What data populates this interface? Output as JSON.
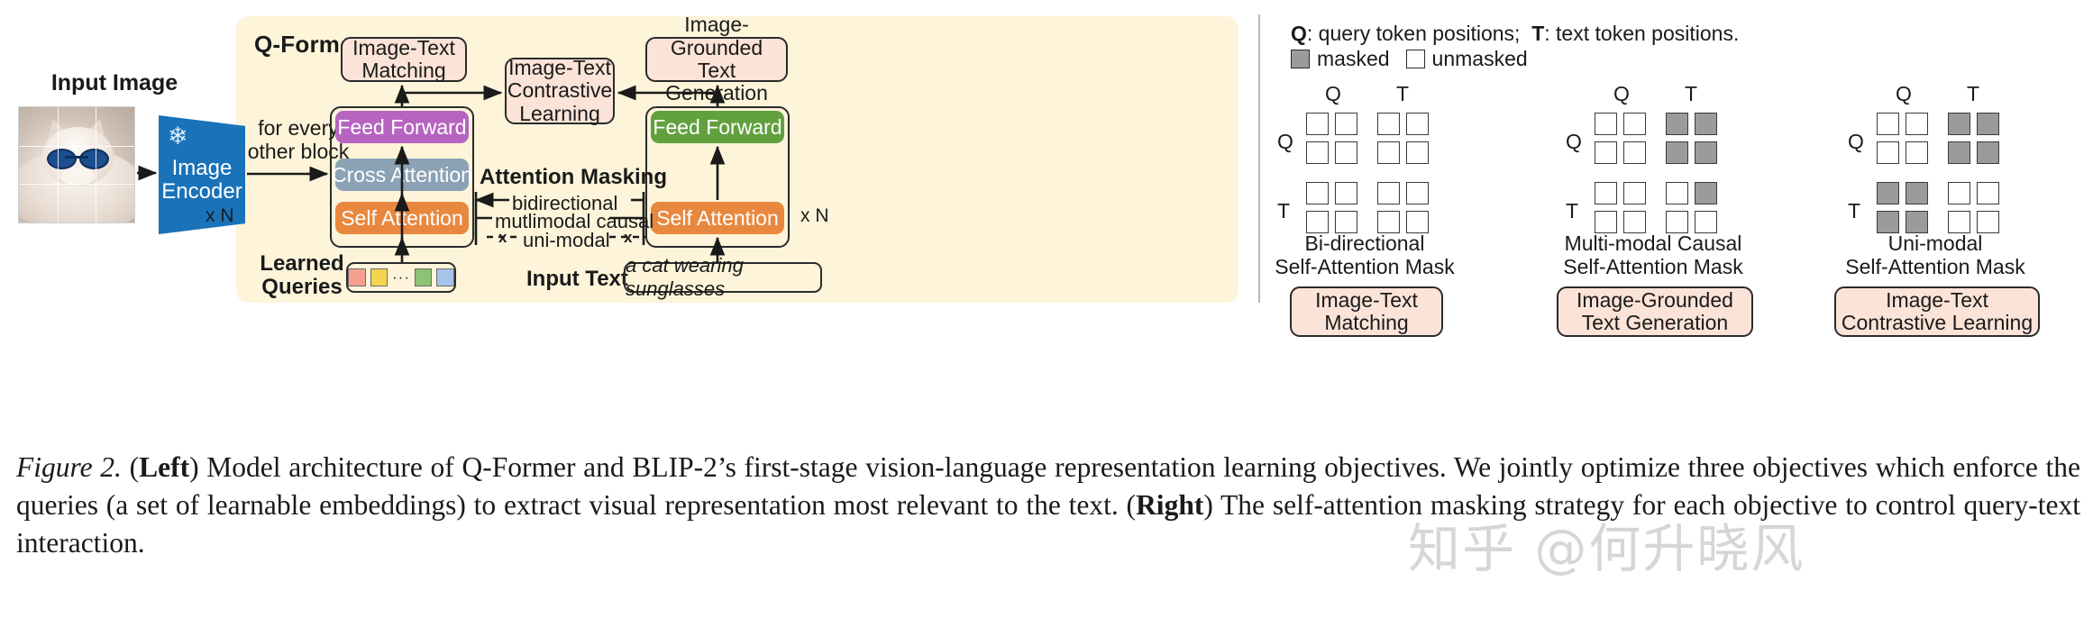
{
  "figure": {
    "label": "Figure 2.",
    "caption_parts": {
      "left_tag": "Left",
      "text_a": ") Model architecture of Q-Former and BLIP-2’s first-stage vision-language representation learning objectives. We jointly optimize three objectives which enforce the queries (a set of learnable embeddings) to extract visual representation most relevant to the text. (",
      "right_tag": "Right",
      "text_b": ") The self-attention masking strategy for each objective to control query-text interaction."
    }
  },
  "left_panel": {
    "panel_title": "Q-Former",
    "input_image_label": "Input Image",
    "image_encoder": {
      "label_line1": "Image",
      "label_line2": "Encoder",
      "frozen_icon": "snowflake-icon"
    },
    "for_every_other_block": "for every\nother block",
    "repeat_left": "x N",
    "repeat_right": "x N",
    "objectives": {
      "image_text_matching": "Image-Text\nMatching",
      "image_text_contrastive_learning": "Image-Text\nContrastive\nLearning",
      "image_grounded_text_generation": "Image-Grounded\nText Generation"
    },
    "left_transformer_blocks": [
      {
        "name": "Feed Forward",
        "color": "#b664c0"
      },
      {
        "name": "Cross Attention",
        "color": "#8ba2b4"
      },
      {
        "name": "Self Attention",
        "color": "#e8883f"
      }
    ],
    "right_transformer_blocks": [
      {
        "name": "Feed Forward",
        "color": "#62a03e"
      },
      {
        "name": "Self Attention",
        "color": "#e8883f"
      }
    ],
    "attention_masking": {
      "title": "Attention Masking",
      "modes": [
        "bidirectional",
        "mutlimodal causal",
        "uni-modal"
      ]
    },
    "learned_queries": {
      "label": "Learned\nQueries",
      "swatch_colors": [
        "#f4a08f",
        "#f6d44d",
        "#8cc275",
        "#a6c3e8"
      ],
      "ellipsis": "···"
    },
    "input_text": {
      "label": "Input Text",
      "value": "a cat wearing sunglasses"
    }
  },
  "right_panel": {
    "legend": {
      "q_key": "Q",
      "q_desc": ": query token positions;",
      "t_key": "T",
      "t_desc": ": text token positions.",
      "masked_label": "masked",
      "unmasked_label": "unmasked",
      "masked_color": "#9b9b9b",
      "unmasked_color": "#ffffff"
    },
    "axis_labels": {
      "col_q": "Q",
      "col_t": "T",
      "row_q": "Q",
      "row_t": "T"
    },
    "masks": [
      {
        "name": "Bi-directional Self-Attention Mask",
        "caption_line1": "Bi-directional",
        "caption_line2": "Self-Attention Mask",
        "objective_tag_line1": "Image-Text",
        "objective_tag_line2": "Matching",
        "matrix": [
          [
            "u",
            "u",
            "u",
            "u"
          ],
          [
            "u",
            "u",
            "u",
            "u"
          ],
          [
            "u",
            "u",
            "u",
            "u"
          ],
          [
            "u",
            "u",
            "u",
            "u"
          ]
        ]
      },
      {
        "name": "Multi-modal Causal Self-Attention Mask",
        "caption_line1": "Multi-modal Causal",
        "caption_line2": "Self-Attention Mask",
        "objective_tag_line1": "Image-Grounded",
        "objective_tag_line2": "Text Generation",
        "matrix": [
          [
            "u",
            "u",
            "m",
            "m"
          ],
          [
            "u",
            "u",
            "m",
            "m"
          ],
          [
            "u",
            "u",
            "u",
            "m"
          ],
          [
            "u",
            "u",
            "u",
            "u"
          ]
        ]
      },
      {
        "name": "Uni-modal Self-Attention Mask",
        "caption_line1": "Uni-modal",
        "caption_line2": "Self-Attention Mask",
        "objective_tag_line1": "Image-Text",
        "objective_tag_line2": "Contrastive Learning",
        "matrix": [
          [
            "u",
            "u",
            "m",
            "m"
          ],
          [
            "u",
            "u",
            "m",
            "m"
          ],
          [
            "m",
            "m",
            "u",
            "u"
          ],
          [
            "m",
            "m",
            "u",
            "u"
          ]
        ]
      }
    ]
  },
  "watermark": {
    "text": "知乎 @何升晓风"
  }
}
